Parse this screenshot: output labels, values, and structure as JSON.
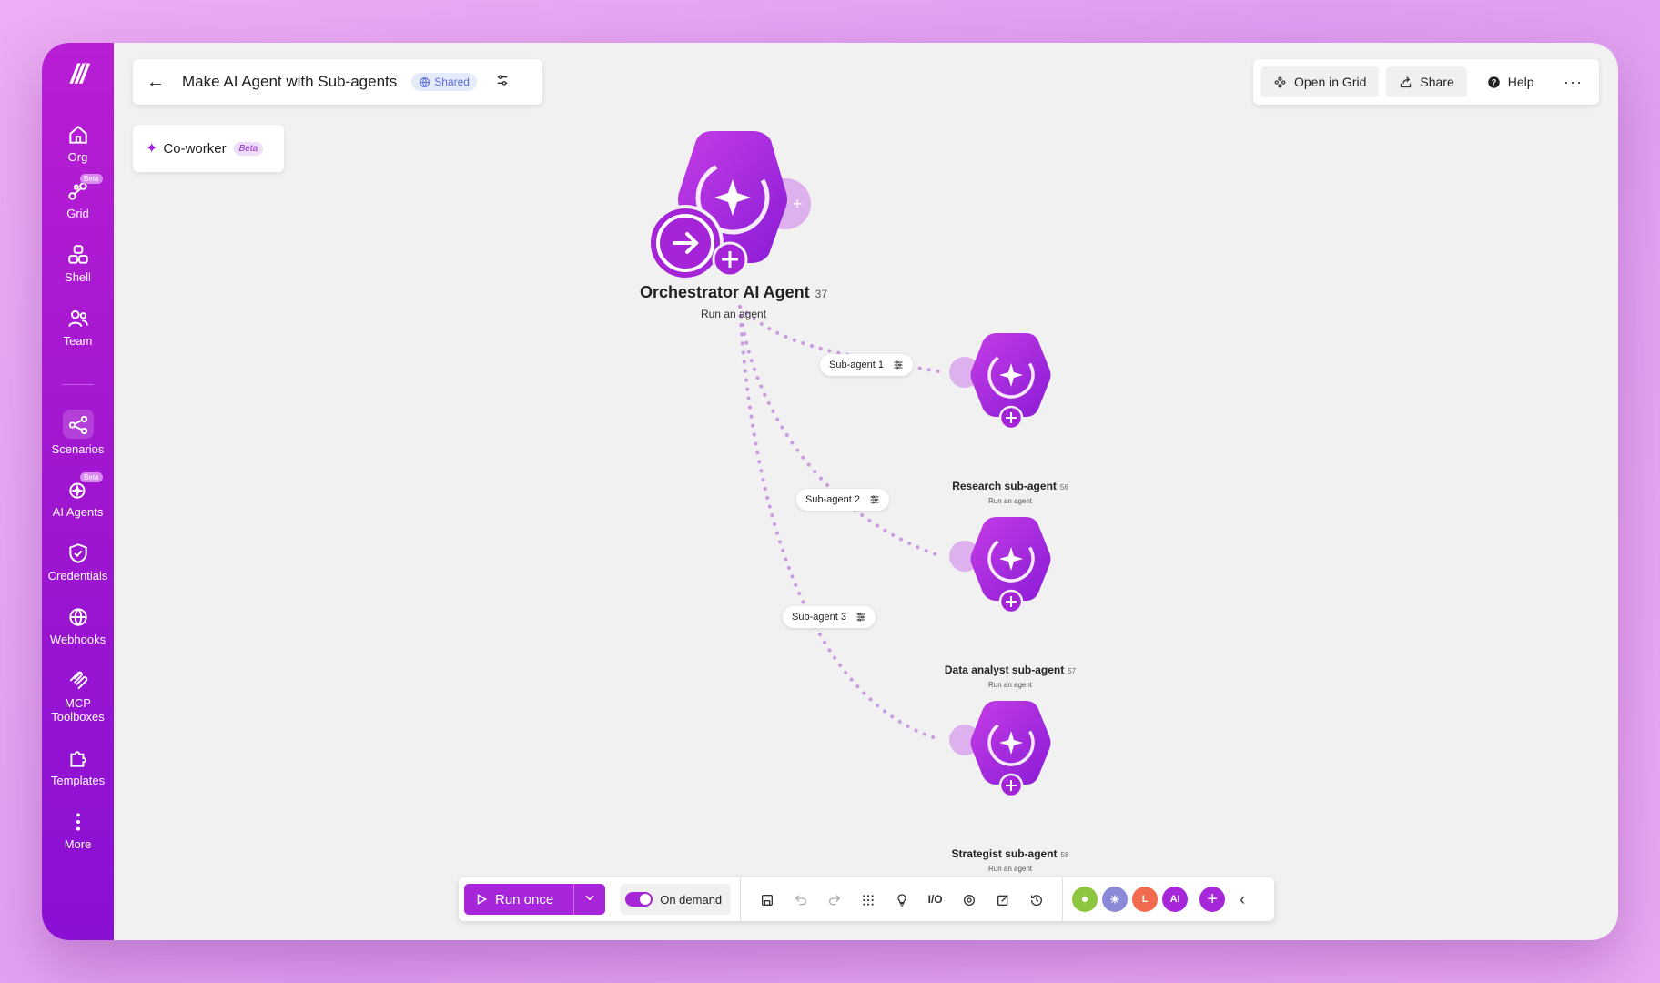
{
  "sidebar": {
    "items": [
      {
        "label": "Org",
        "icon": "home-icon"
      },
      {
        "label": "Grid",
        "icon": "grid-icon",
        "badge": "Beta"
      },
      {
        "label": "Shell",
        "icon": "shell-icon"
      },
      {
        "label": "Team",
        "icon": "team-icon"
      },
      {
        "label": "Scenarios",
        "icon": "scenarios-icon"
      },
      {
        "label": "AI Agents",
        "icon": "ai-agents-icon",
        "badge": "Beta"
      },
      {
        "label": "Credentials",
        "icon": "shield-icon"
      },
      {
        "label": "Webhooks",
        "icon": "globe-icon"
      },
      {
        "label": "MCP Toolboxes",
        "icon": "mcp-icon"
      },
      {
        "label": "Templates",
        "icon": "puzzle-icon"
      },
      {
        "label": "More",
        "icon": "more-vertical-icon"
      }
    ]
  },
  "header": {
    "title": "Make AI Agent with Sub-agents",
    "shared_label": "Shared"
  },
  "coworker": {
    "label": "Co-worker",
    "badge": "Beta"
  },
  "topright": {
    "open_grid": "Open in Grid",
    "share": "Share",
    "help": "Help"
  },
  "nodes": {
    "main": {
      "title": "Orchestrator AI Agent",
      "count": "37",
      "subtitle": "Run an agent"
    },
    "research": {
      "title": "Research sub-agent",
      "count": "56",
      "subtitle": "Run an agent"
    },
    "analyst": {
      "title": "Data analyst sub-agent",
      "count": "57",
      "subtitle": "Run an agent"
    },
    "strategist": {
      "title": "Strategist sub-agent",
      "count": "58",
      "subtitle": "Run an agent"
    }
  },
  "edges": {
    "e1": "Sub-agent 1",
    "e2": "Sub-agent 2",
    "e3": "Sub-agent 3"
  },
  "toolbar": {
    "run_once": "Run once",
    "on_demand": "On demand",
    "io_label": "I/O",
    "apps": [
      {
        "color": "#8cc63f",
        "text": ""
      },
      {
        "color": "#8a8ad8",
        "text": ""
      },
      {
        "color": "#f36b4e",
        "text": "L"
      },
      {
        "color": "#a726d9",
        "text": "AI"
      }
    ]
  },
  "colors": {
    "accent": "#a726d9",
    "sidebar": "#a016d0"
  }
}
